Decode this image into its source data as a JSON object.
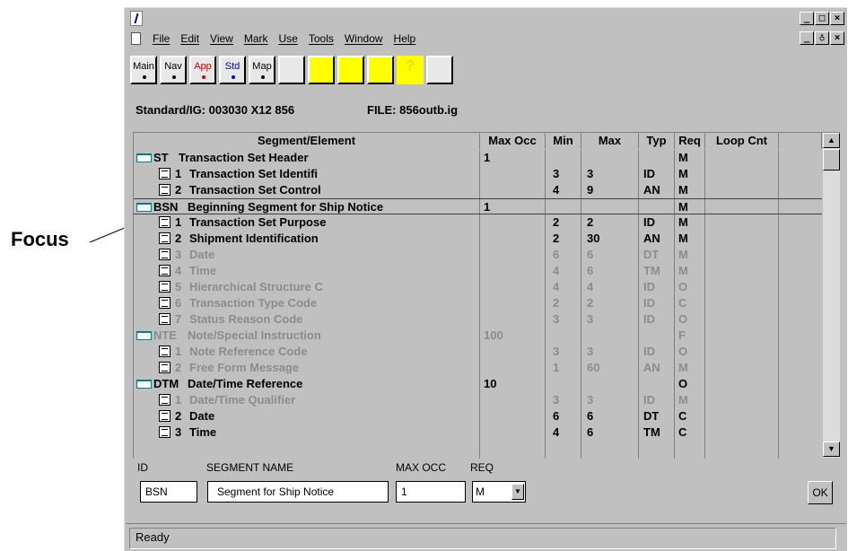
{
  "callout": {
    "label": "Focus"
  },
  "titlebar": {
    "minimize": "_",
    "maximize": "□",
    "close": "×"
  },
  "menubar": {
    "items": [
      "File",
      "Edit",
      "View",
      "Mark",
      "Use",
      "Tools",
      "Window",
      "Help"
    ],
    "mdi_minimize": "_",
    "mdi_restore": "♁",
    "mdi_close": "×"
  },
  "toolbar": {
    "buttons": [
      {
        "label": "Main",
        "icon": "main-icon",
        "color": "#000000"
      },
      {
        "label": "Nav",
        "icon": "nav-icon",
        "color": "#000000"
      },
      {
        "label": "App",
        "icon": "app-icon",
        "color": "#cc0000"
      },
      {
        "label": "Std",
        "icon": "std-icon",
        "color": "#0000cc"
      },
      {
        "label": "Map",
        "icon": "map-icon",
        "color": "#000000"
      },
      {
        "label": "",
        "icon": "compare-icon",
        "color": "#cc0000"
      },
      {
        "label": "",
        "icon": "computer-icon",
        "color": "#808000"
      },
      {
        "label": "",
        "icon": "monitor-icon",
        "color": "#008080"
      },
      {
        "label": "",
        "icon": "tape-icon",
        "color": "#000000"
      },
      {
        "label": "?",
        "icon": "help-icon",
        "color": "#ffd000"
      },
      {
        "label": "",
        "icon": "report-icon",
        "color": "#000000"
      }
    ]
  },
  "standard": {
    "label": "Standard/IG: 003030 X12 856",
    "file": "FILE: 856outb.ig"
  },
  "grid": {
    "columns": [
      "Segment/Element",
      "Max Occ",
      "Min",
      "Max",
      "Typ",
      "Req",
      "Loop Cnt"
    ],
    "rows": [
      {
        "kind": "segment",
        "id": "ST",
        "name": "Transaction Set Header",
        "maxocc": "1",
        "min": "",
        "max": "",
        "typ": "",
        "req": "M",
        "grey": false,
        "focus": false
      },
      {
        "kind": "element",
        "id": "1",
        "name": "Transaction Set Identifi",
        "maxocc": "",
        "min": "3",
        "max": "3",
        "typ": "ID",
        "req": "M",
        "grey": false,
        "focus": false
      },
      {
        "kind": "element",
        "id": "2",
        "name": "Transaction Set Control",
        "maxocc": "",
        "min": "4",
        "max": "9",
        "typ": "AN",
        "req": "M",
        "grey": false,
        "focus": false
      },
      {
        "kind": "segment",
        "id": "BSN",
        "name": "Beginning Segment for Ship Notice",
        "maxocc": "1",
        "min": "",
        "max": "",
        "typ": "",
        "req": "M",
        "grey": false,
        "focus": true
      },
      {
        "kind": "element",
        "id": "1",
        "name": "Transaction Set Purpose",
        "maxocc": "",
        "min": "2",
        "max": "2",
        "typ": "ID",
        "req": "M",
        "grey": false,
        "focus": false
      },
      {
        "kind": "element",
        "id": "2",
        "name": "Shipment Identification",
        "maxocc": "",
        "min": "2",
        "max": "30",
        "typ": "AN",
        "req": "M",
        "grey": false,
        "focus": false
      },
      {
        "kind": "element",
        "id": "3",
        "name": "Date",
        "maxocc": "",
        "min": "6",
        "max": "6",
        "typ": "DT",
        "req": "M",
        "grey": true,
        "focus": false
      },
      {
        "kind": "element",
        "id": "4",
        "name": "Time",
        "maxocc": "",
        "min": "4",
        "max": "6",
        "typ": "TM",
        "req": "M",
        "grey": true,
        "focus": false
      },
      {
        "kind": "element",
        "id": "5",
        "name": "Hierarchical Structure C",
        "maxocc": "",
        "min": "4",
        "max": "4",
        "typ": "ID",
        "req": "O",
        "grey": true,
        "focus": false
      },
      {
        "kind": "element",
        "id": "6",
        "name": "Transaction Type Code",
        "maxocc": "",
        "min": "2",
        "max": "2",
        "typ": "ID",
        "req": "C",
        "grey": true,
        "focus": false
      },
      {
        "kind": "element",
        "id": "7",
        "name": "Status Reason Code",
        "maxocc": "",
        "min": "3",
        "max": "3",
        "typ": "ID",
        "req": "O",
        "grey": true,
        "focus": false
      },
      {
        "kind": "segment",
        "id": "NTE",
        "name": "Note/Special Instruction",
        "maxocc": "100",
        "min": "",
        "max": "",
        "typ": "",
        "req": "F",
        "grey": true,
        "focus": false
      },
      {
        "kind": "element",
        "id": "1",
        "name": "Note Reference Code",
        "maxocc": "",
        "min": "3",
        "max": "3",
        "typ": "ID",
        "req": "O",
        "grey": true,
        "focus": false
      },
      {
        "kind": "element",
        "id": "2",
        "name": "Free Form Message",
        "maxocc": "",
        "min": "1",
        "max": "60",
        "typ": "AN",
        "req": "M",
        "grey": true,
        "focus": false
      },
      {
        "kind": "segment",
        "id": "DTM",
        "name": "Date/Time Reference",
        "maxocc": "10",
        "min": "",
        "max": "",
        "typ": "",
        "req": "O",
        "grey": false,
        "focus": false
      },
      {
        "kind": "element",
        "id": "1",
        "name": "Date/Time Qualifier",
        "maxocc": "",
        "min": "3",
        "max": "3",
        "typ": "ID",
        "req": "M",
        "grey": true,
        "focus": false
      },
      {
        "kind": "element",
        "id": "2",
        "name": "Date",
        "maxocc": "",
        "min": "6",
        "max": "6",
        "typ": "DT",
        "req": "C",
        "grey": false,
        "focus": false
      },
      {
        "kind": "element",
        "id": "3",
        "name": "Time",
        "maxocc": "",
        "min": "4",
        "max": "6",
        "typ": "TM",
        "req": "C",
        "grey": false,
        "focus": false
      }
    ]
  },
  "edit_panel": {
    "id_label": "ID",
    "name_label": "SEGMENT NAME",
    "maxocc_label": "MAX OCC",
    "req_label": "REQ",
    "id_value": "BSN",
    "name_value": "Segment for Ship Notice",
    "maxocc_value": "1",
    "req_value": "M",
    "ok_label": "OK"
  },
  "status": {
    "text": "Ready"
  }
}
